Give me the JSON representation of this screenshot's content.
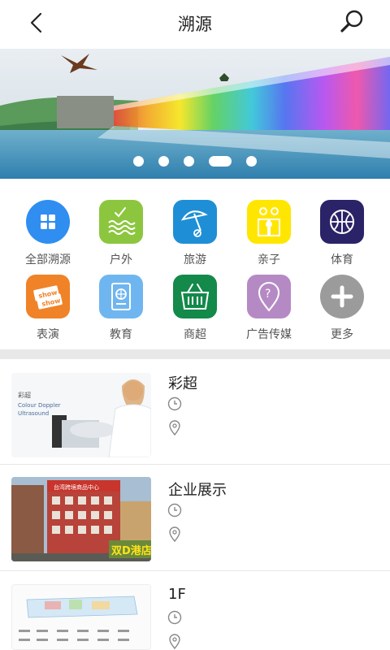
{
  "header": {
    "title": "溯源",
    "back_icon": "back-arrow-icon",
    "search_icon": "search-icon"
  },
  "banner": {
    "slide_count": 5,
    "active_index": 3
  },
  "categories": [
    {
      "label": "全部溯源",
      "icon": "grid-icon",
      "color": "#2f8ef0"
    },
    {
      "label": "户外",
      "icon": "outdoor-icon",
      "color": "#8cc63f"
    },
    {
      "label": "旅游",
      "icon": "umbrella-icon",
      "color": "#1e8fd6"
    },
    {
      "label": "亲子",
      "icon": "family-icon",
      "color": "#ffe600"
    },
    {
      "label": "体育",
      "icon": "basketball-icon",
      "color": "#2b2367"
    },
    {
      "label": "表演",
      "icon": "show-ticket-icon",
      "color": "#f08227"
    },
    {
      "label": "教育",
      "icon": "passport-icon",
      "color": "#6fb6f0"
    },
    {
      "label": "商超",
      "icon": "basket-icon",
      "color": "#13894a"
    },
    {
      "label": "广告传媒",
      "icon": "location-question-icon",
      "color": "#b58ac4"
    },
    {
      "label": "更多",
      "icon": "plus-icon",
      "color": "#9b9b9b"
    }
  ],
  "list": [
    {
      "title": "彩超",
      "thumb_caption": "彩超",
      "thumb_sub": "Colour Doppler\nUltrasound"
    },
    {
      "title": "企业展示",
      "thumb_sign": "台湾跨境商品中心",
      "thumb_tag": "双D港店"
    },
    {
      "title": "1F"
    }
  ],
  "colors": {
    "accent": "#2f8ef0",
    "separator": "#e8e8e8"
  }
}
